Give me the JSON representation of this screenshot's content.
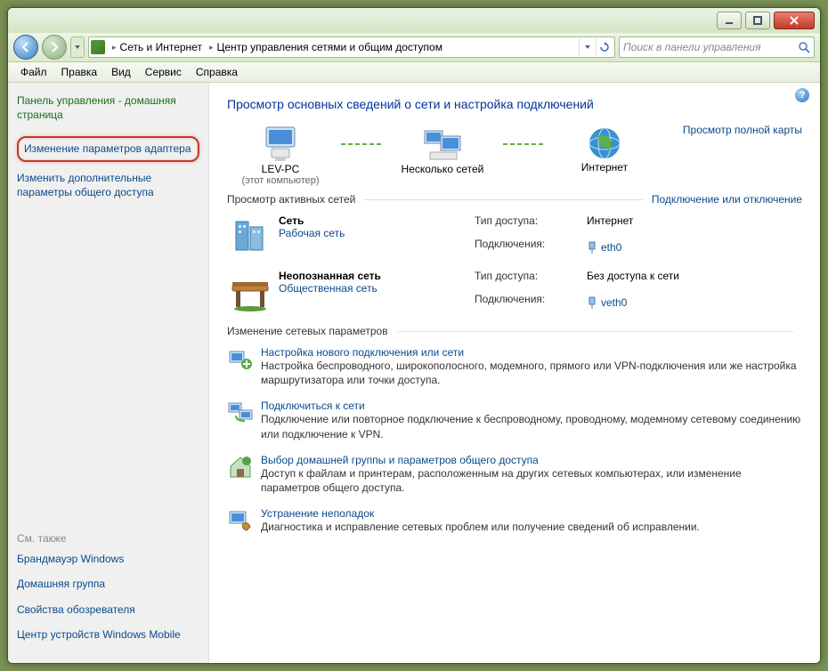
{
  "titlebar": {
    "min": "_",
    "max": "❐",
    "close": "✕"
  },
  "breadcrumb": {
    "seg1": "Сеть и Интернет",
    "seg2": "Центр управления сетями и общим доступом"
  },
  "search": {
    "placeholder": "Поиск в панели управления"
  },
  "menu": {
    "file": "Файл",
    "edit": "Правка",
    "view": "Вид",
    "service": "Сервис",
    "help": "Справка"
  },
  "sidebar": {
    "cp_home": "Панель управления - домашняя страница",
    "adapter": "Изменение параметров адаптера",
    "sharing": "Изменить дополнительные параметры общего доступа",
    "see_also": "См. также",
    "firewall": "Брандмауэр Windows",
    "homegroup": "Домашняя группа",
    "ie": "Свойства обозревателя",
    "wm": "Центр устройств Windows Mobile"
  },
  "heading": "Просмотр основных сведений о сети и настройка подключений",
  "netmap": {
    "node1": "LEV-PC",
    "node1_sub": "(этот компьютер)",
    "node2": "Несколько сетей",
    "node3": "Интернет",
    "fullmap": "Просмотр полной карты"
  },
  "active_networks": {
    "title": "Просмотр активных сетей",
    "link": "Подключение или отключение"
  },
  "networks": [
    {
      "name": "Сеть",
      "type": "Рабочая сеть",
      "access_lbl": "Тип доступа:",
      "access_val": "Интернет",
      "conn_lbl": "Подключения:",
      "conn_val": "eth0"
    },
    {
      "name": "Неопознанная сеть",
      "type": "Общественная сеть",
      "access_lbl": "Тип доступа:",
      "access_val": "Без доступа к сети",
      "conn_lbl": "Подключения:",
      "conn_val": "veth0"
    }
  ],
  "change_settings": "Изменение сетевых параметров",
  "settings": [
    {
      "title": "Настройка нового подключения или сети",
      "desc": "Настройка беспроводного, широкополосного, модемного, прямого или VPN-подключения или же настройка маршрутизатора или точки доступа."
    },
    {
      "title": "Подключиться к сети",
      "desc": "Подключение или повторное подключение к беспроводному, проводному, модемному сетевому соединению или подключение к VPN."
    },
    {
      "title": "Выбор домашней группы и параметров общего доступа",
      "desc": "Доступ к файлам и принтерам, расположенным на других сетевых компьютерах, или изменение параметров общего доступа."
    },
    {
      "title": "Устранение неполадок",
      "desc": "Диагностика и исправление сетевых проблем или получение сведений об исправлении."
    }
  ]
}
